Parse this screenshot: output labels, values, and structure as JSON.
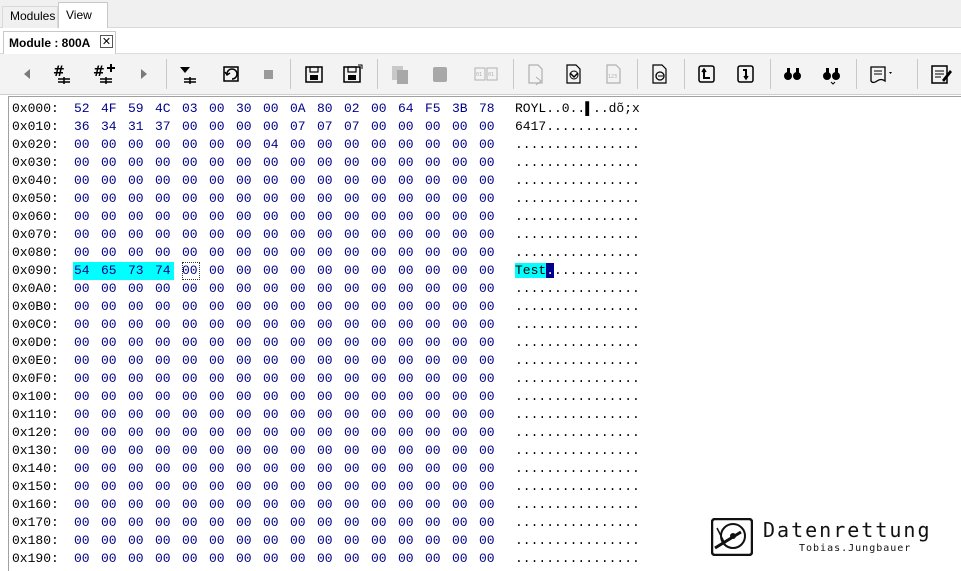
{
  "tabs": [
    {
      "label": "Modules"
    },
    {
      "label": "View"
    }
  ],
  "document_tab": {
    "label": "Module : 800A",
    "close_glyph": "✕"
  },
  "toolbar": {
    "buttons": [
      {
        "name": "back-icon"
      },
      {
        "name": "hash-icon"
      },
      {
        "name": "hash-add-icon"
      },
      {
        "name": "forward-icon"
      },
      {
        "name": "download-row-icon"
      },
      {
        "name": "refresh-icon"
      },
      {
        "name": "stop-icon"
      },
      {
        "name": "save-icon"
      },
      {
        "name": "save-as-icon"
      },
      {
        "name": "copy-icon"
      },
      {
        "name": "paste-icon"
      },
      {
        "name": "compare-icon"
      },
      {
        "name": "export-icon"
      },
      {
        "name": "import-icon"
      },
      {
        "name": "decimal-icon"
      },
      {
        "name": "goto-icon"
      },
      {
        "name": "upload-icon"
      },
      {
        "name": "download-icon"
      },
      {
        "name": "find-icon"
      },
      {
        "name": "find-next-icon"
      },
      {
        "name": "script-icon"
      },
      {
        "name": "notes-icon"
      }
    ]
  },
  "hex": {
    "rows": [
      {
        "addr": "0x000:",
        "bytes": [
          "52",
          "4F",
          "59",
          "4C",
          "03",
          "00",
          "30",
          "00",
          "0A",
          "80",
          "02",
          "00",
          "64",
          "F5",
          "3B",
          "78"
        ],
        "ascii": "ROYL..0..▌..dõ;x"
      },
      {
        "addr": "0x010:",
        "bytes": [
          "36",
          "34",
          "31",
          "37",
          "00",
          "00",
          "00",
          "00",
          "07",
          "07",
          "07",
          "00",
          "00",
          "00",
          "00",
          "00"
        ],
        "ascii": "6417............"
      },
      {
        "addr": "0x020:",
        "bytes": [
          "00",
          "00",
          "00",
          "00",
          "00",
          "00",
          "00",
          "04",
          "00",
          "00",
          "00",
          "00",
          "00",
          "00",
          "00",
          "00"
        ],
        "ascii": "................"
      },
      {
        "addr": "0x030:",
        "bytes": [
          "00",
          "00",
          "00",
          "00",
          "00",
          "00",
          "00",
          "00",
          "00",
          "00",
          "00",
          "00",
          "00",
          "00",
          "00",
          "00"
        ],
        "ascii": "................"
      },
      {
        "addr": "0x040:",
        "bytes": [
          "00",
          "00",
          "00",
          "00",
          "00",
          "00",
          "00",
          "00",
          "00",
          "00",
          "00",
          "00",
          "00",
          "00",
          "00",
          "00"
        ],
        "ascii": "................"
      },
      {
        "addr": "0x050:",
        "bytes": [
          "00",
          "00",
          "00",
          "00",
          "00",
          "00",
          "00",
          "00",
          "00",
          "00",
          "00",
          "00",
          "00",
          "00",
          "00",
          "00"
        ],
        "ascii": "................"
      },
      {
        "addr": "0x060:",
        "bytes": [
          "00",
          "00",
          "00",
          "00",
          "00",
          "00",
          "00",
          "00",
          "00",
          "00",
          "00",
          "00",
          "00",
          "00",
          "00",
          "00"
        ],
        "ascii": "................"
      },
      {
        "addr": "0x070:",
        "bytes": [
          "00",
          "00",
          "00",
          "00",
          "00",
          "00",
          "00",
          "00",
          "00",
          "00",
          "00",
          "00",
          "00",
          "00",
          "00",
          "00"
        ],
        "ascii": "................"
      },
      {
        "addr": "0x080:",
        "bytes": [
          "00",
          "00",
          "00",
          "00",
          "00",
          "00",
          "00",
          "00",
          "00",
          "00",
          "00",
          "00",
          "00",
          "00",
          "00",
          "00"
        ],
        "ascii": "................"
      },
      {
        "addr": "0x090:",
        "bytes": [
          "54",
          "65",
          "73",
          "74",
          "00",
          "00",
          "00",
          "00",
          "00",
          "00",
          "00",
          "00",
          "00",
          "00",
          "00",
          "00"
        ],
        "ascii": "Test............",
        "highlight_count": 4,
        "cursor_index": 4
      },
      {
        "addr": "0x0A0:",
        "bytes": [
          "00",
          "00",
          "00",
          "00",
          "00",
          "00",
          "00",
          "00",
          "00",
          "00",
          "00",
          "00",
          "00",
          "00",
          "00",
          "00"
        ],
        "ascii": "................"
      },
      {
        "addr": "0x0B0:",
        "bytes": [
          "00",
          "00",
          "00",
          "00",
          "00",
          "00",
          "00",
          "00",
          "00",
          "00",
          "00",
          "00",
          "00",
          "00",
          "00",
          "00"
        ],
        "ascii": "................"
      },
      {
        "addr": "0x0C0:",
        "bytes": [
          "00",
          "00",
          "00",
          "00",
          "00",
          "00",
          "00",
          "00",
          "00",
          "00",
          "00",
          "00",
          "00",
          "00",
          "00",
          "00"
        ],
        "ascii": "................"
      },
      {
        "addr": "0x0D0:",
        "bytes": [
          "00",
          "00",
          "00",
          "00",
          "00",
          "00",
          "00",
          "00",
          "00",
          "00",
          "00",
          "00",
          "00",
          "00",
          "00",
          "00"
        ],
        "ascii": "................"
      },
      {
        "addr": "0x0E0:",
        "bytes": [
          "00",
          "00",
          "00",
          "00",
          "00",
          "00",
          "00",
          "00",
          "00",
          "00",
          "00",
          "00",
          "00",
          "00",
          "00",
          "00"
        ],
        "ascii": "................"
      },
      {
        "addr": "0x0F0:",
        "bytes": [
          "00",
          "00",
          "00",
          "00",
          "00",
          "00",
          "00",
          "00",
          "00",
          "00",
          "00",
          "00",
          "00",
          "00",
          "00",
          "00"
        ],
        "ascii": "................"
      },
      {
        "addr": "0x100:",
        "bytes": [
          "00",
          "00",
          "00",
          "00",
          "00",
          "00",
          "00",
          "00",
          "00",
          "00",
          "00",
          "00",
          "00",
          "00",
          "00",
          "00"
        ],
        "ascii": "................"
      },
      {
        "addr": "0x110:",
        "bytes": [
          "00",
          "00",
          "00",
          "00",
          "00",
          "00",
          "00",
          "00",
          "00",
          "00",
          "00",
          "00",
          "00",
          "00",
          "00",
          "00"
        ],
        "ascii": "................"
      },
      {
        "addr": "0x120:",
        "bytes": [
          "00",
          "00",
          "00",
          "00",
          "00",
          "00",
          "00",
          "00",
          "00",
          "00",
          "00",
          "00",
          "00",
          "00",
          "00",
          "00"
        ],
        "ascii": "................"
      },
      {
        "addr": "0x130:",
        "bytes": [
          "00",
          "00",
          "00",
          "00",
          "00",
          "00",
          "00",
          "00",
          "00",
          "00",
          "00",
          "00",
          "00",
          "00",
          "00",
          "00"
        ],
        "ascii": "................"
      },
      {
        "addr": "0x140:",
        "bytes": [
          "00",
          "00",
          "00",
          "00",
          "00",
          "00",
          "00",
          "00",
          "00",
          "00",
          "00",
          "00",
          "00",
          "00",
          "00",
          "00"
        ],
        "ascii": "................"
      },
      {
        "addr": "0x150:",
        "bytes": [
          "00",
          "00",
          "00",
          "00",
          "00",
          "00",
          "00",
          "00",
          "00",
          "00",
          "00",
          "00",
          "00",
          "00",
          "00",
          "00"
        ],
        "ascii": "................"
      },
      {
        "addr": "0x160:",
        "bytes": [
          "00",
          "00",
          "00",
          "00",
          "00",
          "00",
          "00",
          "00",
          "00",
          "00",
          "00",
          "00",
          "00",
          "00",
          "00",
          "00"
        ],
        "ascii": "................"
      },
      {
        "addr": "0x170:",
        "bytes": [
          "00",
          "00",
          "00",
          "00",
          "00",
          "00",
          "00",
          "00",
          "00",
          "00",
          "00",
          "00",
          "00",
          "00",
          "00",
          "00"
        ],
        "ascii": "................"
      },
      {
        "addr": "0x180:",
        "bytes": [
          "00",
          "00",
          "00",
          "00",
          "00",
          "00",
          "00",
          "00",
          "00",
          "00",
          "00",
          "00",
          "00",
          "00",
          "00",
          "00"
        ],
        "ascii": "................"
      },
      {
        "addr": "0x190:",
        "bytes": [
          "00",
          "00",
          "00",
          "00",
          "00",
          "00",
          "00",
          "00",
          "00",
          "00",
          "00",
          "00",
          "00",
          "00",
          "00",
          "00"
        ],
        "ascii": "................"
      }
    ]
  },
  "logo": {
    "title": "Datenrettung",
    "subtitle": "Tobias.Jungbauer"
  },
  "colors": {
    "byte": "#00008b",
    "highlight": "#00ffff",
    "cursor": "#00008b"
  }
}
